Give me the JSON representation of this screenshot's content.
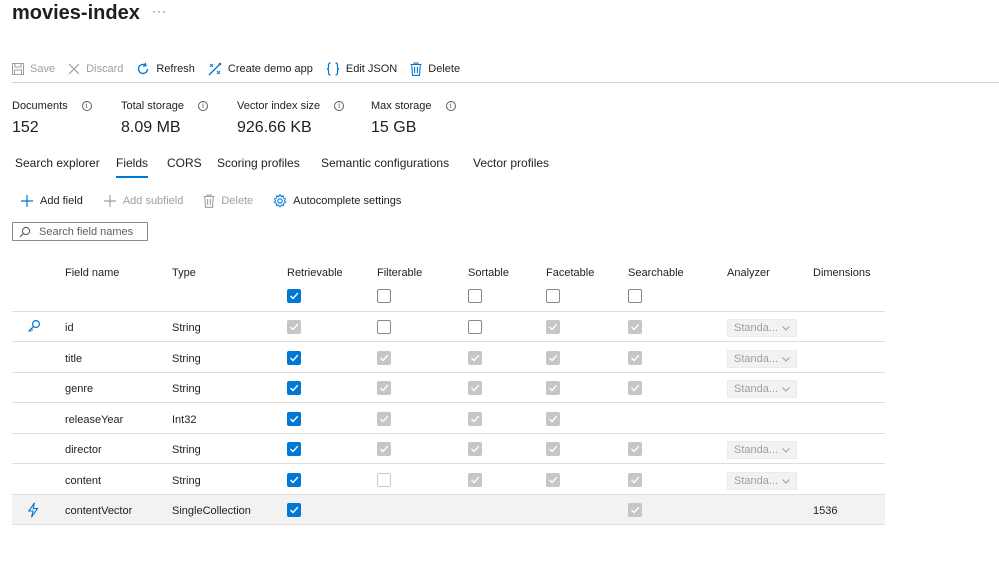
{
  "page": {
    "title": "movies-index",
    "more": "···"
  },
  "toolbar": {
    "save": "Save",
    "discard": "Discard",
    "refresh": "Refresh",
    "create_demo_app": "Create demo app",
    "edit_json": "Edit JSON",
    "delete": "Delete"
  },
  "stats": [
    {
      "label": "Documents",
      "value": "152"
    },
    {
      "label": "Total storage",
      "value": "8.09 MB"
    },
    {
      "label": "Vector index size",
      "value": "926.66 KB"
    },
    {
      "label": "Max storage",
      "value": "15 GB"
    }
  ],
  "tabs": [
    {
      "label": "Search explorer",
      "active": false
    },
    {
      "label": "Fields",
      "active": true
    },
    {
      "label": "CORS",
      "active": false
    },
    {
      "label": "Scoring profiles",
      "active": false
    },
    {
      "label": "Semantic configurations",
      "active": false
    },
    {
      "label": "Vector profiles",
      "active": false
    }
  ],
  "commands": {
    "add_field": "Add field",
    "add_subfield": "Add subfield",
    "delete": "Delete",
    "autocomplete": "Autocomplete settings"
  },
  "search": {
    "placeholder": "Search field names",
    "value": ""
  },
  "columns": {
    "field_name": "Field name",
    "type": "Type",
    "retrievable": "Retrievable",
    "filterable": "Filterable",
    "sortable": "Sortable",
    "facetable": "Facetable",
    "searchable": "Searchable",
    "analyzer": "Analyzer",
    "dimensions": "Dimensions"
  },
  "header_checks": {
    "retrievable": "on",
    "filterable": "off",
    "sortable": "off",
    "facetable": "off",
    "searchable": "off"
  },
  "rows": [
    {
      "icon": "key-icon",
      "name": "id",
      "type": "String",
      "retrievable": "dis-on",
      "filterable": "off",
      "sortable": "off",
      "facetable": "dis-on",
      "searchable": "dis-on",
      "analyzer": "Standa...",
      "dimensions": ""
    },
    {
      "icon": "",
      "name": "title",
      "type": "String",
      "retrievable": "on",
      "filterable": "dis-on",
      "sortable": "dis-on",
      "facetable": "dis-on",
      "searchable": "dis-on",
      "analyzer": "Standa...",
      "dimensions": ""
    },
    {
      "icon": "",
      "name": "genre",
      "type": "String",
      "retrievable": "on",
      "filterable": "dis-on",
      "sortable": "dis-on",
      "facetable": "dis-on",
      "searchable": "dis-on",
      "analyzer": "Standa...",
      "dimensions": ""
    },
    {
      "icon": "",
      "name": "releaseYear",
      "type": "Int32",
      "retrievable": "on",
      "filterable": "dis-on",
      "sortable": "dis-on",
      "facetable": "dis-on",
      "searchable": "",
      "analyzer": "",
      "dimensions": ""
    },
    {
      "icon": "",
      "name": "director",
      "type": "String",
      "retrievable": "on",
      "filterable": "dis-on",
      "sortable": "dis-on",
      "facetable": "dis-on",
      "searchable": "dis-on",
      "analyzer": "Standa...",
      "dimensions": ""
    },
    {
      "icon": "",
      "name": "content",
      "type": "String",
      "retrievable": "on",
      "filterable": "dis-off",
      "sortable": "dis-on",
      "facetable": "dis-on",
      "searchable": "dis-on",
      "analyzer": "Standa...",
      "dimensions": ""
    },
    {
      "icon": "lightning-icon",
      "name": "contentVector",
      "type": "SingleCollection",
      "retrievable": "on",
      "filterable": "",
      "sortable": "",
      "facetable": "",
      "searchable": "dis-on",
      "analyzer": "",
      "dimensions": "1536",
      "selected": true
    }
  ],
  "colors": {
    "accent": "#0078d4",
    "disabled": "#c8c6c4",
    "selected_row": "#f3f2f1"
  }
}
